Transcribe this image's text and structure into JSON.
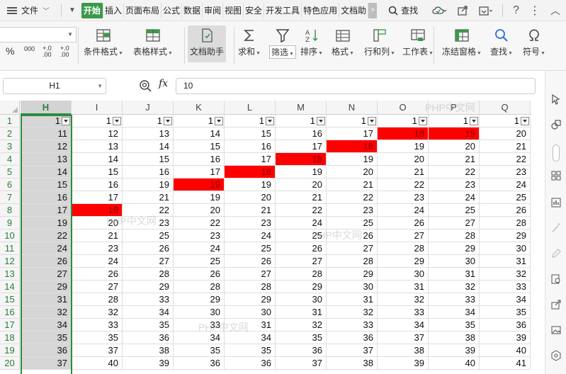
{
  "menu": {
    "file_label": "文件",
    "tabs": [
      "开始",
      "插入",
      "页面布局",
      "公式",
      "数据",
      "审阅",
      "视图",
      "安全",
      "开发工具",
      "特色应用",
      "文档助"
    ],
    "active_tab": "开始",
    "more_label": ">",
    "search_label": "查找"
  },
  "ribbon": {
    "number_format_labels": [
      "%",
      "000",
      "+.0 .00",
      "+.0 .00"
    ],
    "buttons": [
      {
        "label": "条件格式",
        "icon": "conditional-format-icon",
        "dropdown": true
      },
      {
        "label": "表格样式",
        "icon": "table-style-icon",
        "dropdown": true
      },
      {
        "label": "文档助手",
        "icon": "doc-assistant-icon",
        "dropdown": false
      },
      {
        "label": "求和",
        "icon": "sum-icon",
        "dropdown": true
      },
      {
        "label": "筛选",
        "icon": "filter-icon",
        "dropdown": true
      },
      {
        "label": "排序",
        "icon": "sort-icon",
        "dropdown": true
      },
      {
        "label": "格式",
        "icon": "format-icon",
        "dropdown": true
      },
      {
        "label": "行和列",
        "icon": "rows-cols-icon",
        "dropdown": true
      },
      {
        "label": "工作表",
        "icon": "worksheet-icon",
        "dropdown": true
      },
      {
        "label": "冻结窗格",
        "icon": "freeze-panes-icon",
        "dropdown": true
      },
      {
        "label": "查找",
        "icon": "find-icon",
        "dropdown": true
      },
      {
        "label": "符号",
        "icon": "symbol-icon",
        "dropdown": true
      }
    ]
  },
  "formula_bar": {
    "name_box": "H1",
    "fx_label": "fx",
    "formula": "10"
  },
  "sheet": {
    "columns": [
      "H",
      "I",
      "J",
      "K",
      "L",
      "M",
      "N",
      "O",
      "P",
      "Q"
    ],
    "selected_column": "H",
    "header_row_values": [
      "1",
      "1",
      "1",
      "1",
      "1",
      "1",
      "1",
      "1",
      "1",
      "1"
    ],
    "rows": [
      {
        "n": "1",
        "cells": [
          "",
          "",
          "",
          "",
          "",
          "",
          "",
          "",
          "",
          ""
        ]
      },
      {
        "n": "2",
        "cells": [
          "11",
          "12",
          "13",
          "14",
          "15",
          "16",
          "17",
          "18",
          "19",
          "20"
        ]
      },
      {
        "n": "3",
        "cells": [
          "12",
          "13",
          "14",
          "15",
          "16",
          "17",
          "18",
          "19",
          "20",
          "21"
        ]
      },
      {
        "n": "4",
        "cells": [
          "13",
          "14",
          "15",
          "16",
          "17",
          "18",
          "19",
          "20",
          "21",
          "22"
        ]
      },
      {
        "n": "5",
        "cells": [
          "14",
          "15",
          "16",
          "17",
          "18",
          "19",
          "20",
          "21",
          "22",
          "23"
        ]
      },
      {
        "n": "6",
        "cells": [
          "15",
          "16",
          "19",
          "19",
          "19",
          "20",
          "21",
          "22",
          "23",
          "24"
        ]
      },
      {
        "n": "7",
        "cells": [
          "16",
          "17",
          "21",
          "19",
          "20",
          "21",
          "22",
          "23",
          "24",
          "25"
        ]
      },
      {
        "n": "8",
        "cells": [
          "17",
          "18",
          "22",
          "20",
          "21",
          "22",
          "23",
          "24",
          "25",
          "26"
        ]
      },
      {
        "n": "9",
        "cells": [
          "19",
          "20",
          "23",
          "22",
          "23",
          "24",
          "25",
          "26",
          "27",
          "28"
        ]
      },
      {
        "n": "10",
        "cells": [
          "22",
          "21",
          "25",
          "23",
          "24",
          "25",
          "26",
          "27",
          "28",
          "29"
        ]
      },
      {
        "n": "11",
        "cells": [
          "24",
          "23",
          "26",
          "24",
          "25",
          "26",
          "27",
          "28",
          "29",
          "30"
        ]
      },
      {
        "n": "12",
        "cells": [
          "26",
          "24",
          "27",
          "25",
          "26",
          "27",
          "28",
          "29",
          "30",
          "31"
        ]
      },
      {
        "n": "13",
        "cells": [
          "27",
          "26",
          "28",
          "26",
          "27",
          "28",
          "29",
          "30",
          "31",
          "32"
        ]
      },
      {
        "n": "14",
        "cells": [
          "29",
          "27",
          "29",
          "28",
          "28",
          "29",
          "30",
          "31",
          "32",
          "33"
        ]
      },
      {
        "n": "15",
        "cells": [
          "31",
          "28",
          "33",
          "29",
          "29",
          "30",
          "31",
          "32",
          "33",
          "34"
        ]
      },
      {
        "n": "16",
        "cells": [
          "32",
          "32",
          "34",
          "30",
          "30",
          "31",
          "32",
          "33",
          "34",
          "35"
        ]
      },
      {
        "n": "17",
        "cells": [
          "34",
          "33",
          "35",
          "33",
          "31",
          "32",
          "33",
          "34",
          "35",
          "36"
        ]
      },
      {
        "n": "18",
        "cells": [
          "35",
          "35",
          "36",
          "34",
          "34",
          "35",
          "36",
          "37",
          "38",
          "39"
        ]
      },
      {
        "n": "19",
        "cells": [
          "36",
          "37",
          "38",
          "35",
          "35",
          "36",
          "37",
          "38",
          "39",
          "40"
        ]
      },
      {
        "n": "20",
        "cells": [
          "37",
          "40",
          "39",
          "36",
          "36",
          "37",
          "38",
          "39",
          "40",
          "41"
        ]
      }
    ],
    "red_cells": [
      [
        "2",
        "O"
      ],
      [
        "2",
        "P"
      ],
      [
        "3",
        "N"
      ],
      [
        "4",
        "M"
      ],
      [
        "5",
        "L"
      ],
      [
        "6",
        "K"
      ],
      [
        "8",
        "I"
      ]
    ],
    "red_color": "#ff0000",
    "select_color": "#2a8c3e"
  },
  "watermarks": [
    "PHP中文网",
    "PHP中文网",
    "PHP中文网",
    "PHP中文网"
  ]
}
